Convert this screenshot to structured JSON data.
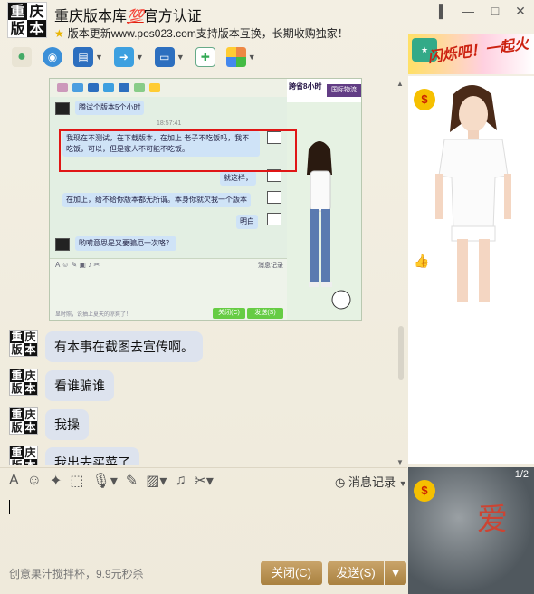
{
  "window": {
    "title": "重庆版本库",
    "title_badge": "💯",
    "title_suffix": "官方认证",
    "signature": "版本更新www.pos023.com支持版本互换，长期收购独家！",
    "avatar_chars": [
      "重",
      "庆",
      "版",
      "本"
    ]
  },
  "ad": {
    "text": "闪烁吧！一起火"
  },
  "toolbar": {
    "items": [
      "voice-call-icon",
      "video-call-icon",
      "screen-share-icon",
      "file-transfer-icon",
      "remote-desktop-icon",
      "invite-icon",
      "apps-icon"
    ]
  },
  "screenshot": {
    "time": "18:57:41",
    "ad1": "跨省8小时",
    "ad2": "国际物流",
    "msg0": "腾试个版本5个小时",
    "msg1": "我现在不测试，在下载版本，在加上 老子不吃饭吗，我不吃饭，可以，但是家人不可能不吃饭。",
    "msg2": "就这样，",
    "msg3": "在加上，给不给你版本都无所谓。本身你就欠我一个版本",
    "msg4": "明白",
    "msg5": "哟嗬意思是又要骗厄一次咯？",
    "history": "消息记录",
    "footer": "显时照，说抽上夏天的凉爽了！",
    "close_btn": "关闭(C)",
    "send_btn": "发送(S)"
  },
  "messages": [
    {
      "text": "有本事在截图去宣传啊。"
    },
    {
      "text": "看谁骗谁"
    },
    {
      "text": "我操"
    },
    {
      "text": "我出去买菜了"
    }
  ],
  "input": {
    "history_label": "消息记录",
    "promo": "创意果汁搅拌杯，9.9元秒杀",
    "close_label": "关闭(C)",
    "send_label": "发送(S)"
  },
  "right_bottom": {
    "page": "1/2",
    "text": "爱"
  },
  "colors": {
    "title_badge": "#d21",
    "bubble": "#dde3ee",
    "buttons": "#b08a4a",
    "highlight": "#e01616"
  }
}
